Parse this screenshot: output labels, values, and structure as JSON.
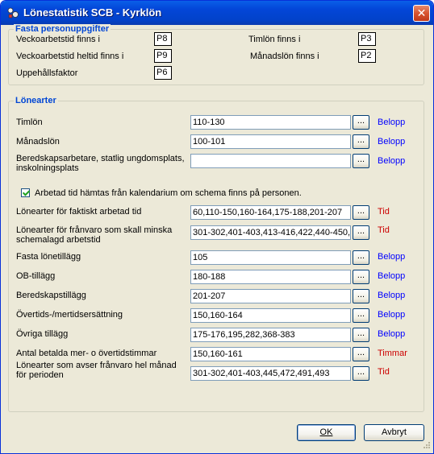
{
  "window": {
    "title": "Lönestatistik  SCB - Kyrklön"
  },
  "fasta": {
    "title": "Fasta personuppgifter",
    "veckoarbetstid_label": "Veckoarbetstid finns i",
    "veckoarbetstid_value": "P8",
    "heltid_label": "Veckoarbetstid heltid finns i",
    "heltid_value": "P9",
    "upphall_label": "Uppehållsfaktor",
    "upphall_value": "P6",
    "timlon_label": "Timlön finns i",
    "timlon_value": "P3",
    "manadslon_label": "Månadslön finns i",
    "manadslon_value": "P2"
  },
  "lonearter": {
    "title": "Lönearter",
    "checkbox_label": "Arbetad tid hämtas från kalendarium om schema finns på personen.",
    "checkbox_checked": true,
    "browse_label": "...",
    "rows": [
      {
        "label": "Timlön",
        "value": "110-130",
        "unit": "Belopp"
      },
      {
        "label": "Månadslön",
        "value": "100-101",
        "unit": "Belopp"
      },
      {
        "label": "Beredskapsarbetare, statlig ungdomsplats,\ninskolningsplats",
        "value": "",
        "unit": "Belopp"
      },
      {
        "label": "Lönearter för faktiskt arbetad tid",
        "value": "60,110-150,160-164,175-188,201-207",
        "unit": "Tid"
      },
      {
        "label": "Lönearter för frånvaro som skall minska\nschemalagd arbetstid",
        "value": "301-302,401-403,413-416,422,440-450,4",
        "unit": "Tid"
      },
      {
        "label": "Fasta lönetillägg",
        "value": "105",
        "unit": "Belopp"
      },
      {
        "label": "OB-tillägg",
        "value": "180-188",
        "unit": "Belopp"
      },
      {
        "label": "Beredskapstillägg",
        "value": "201-207",
        "unit": "Belopp"
      },
      {
        "label": "Övertids-/mertidsersättning",
        "value": "150,160-164",
        "unit": "Belopp"
      },
      {
        "label": "Övriga tillägg",
        "value": "175-176,195,282,368-383",
        "unit": "Belopp"
      },
      {
        "label": "Antal betalda mer- o övertidstimmar",
        "value": "150,160-161",
        "unit": "Timmar"
      },
      {
        "label": "Lönearter som avser frånvaro hel månad\nför perioden",
        "value": "301-302,401-403,445,472,491,493",
        "unit": "Tid"
      }
    ]
  },
  "buttons": {
    "ok": "OK",
    "cancel": "Avbryt"
  },
  "colors": {
    "titlebar": "#0a5fe8",
    "group_title": "#0046d5",
    "unit_belopp": "#0000ff",
    "unit_tid": "#cc0000"
  }
}
